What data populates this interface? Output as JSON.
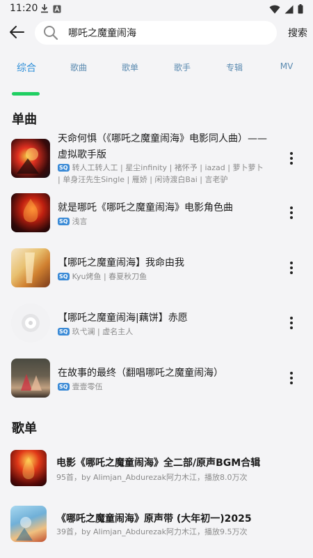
{
  "status_bar": {
    "time": "11:20",
    "icons": [
      "download-icon",
      "a-icon",
      "wifi-icon",
      "signal-icon",
      "battery-icon"
    ]
  },
  "header": {
    "search_query": "哪吒之魔童闹海",
    "search_button": "搜索"
  },
  "tabs": [
    {
      "label": "综合",
      "active": true
    },
    {
      "label": "歌曲",
      "active": false
    },
    {
      "label": "歌单",
      "active": false
    },
    {
      "label": "歌手",
      "active": false
    },
    {
      "label": "专辑",
      "active": false
    },
    {
      "label": "MV",
      "active": false
    }
  ],
  "songs_section": {
    "title": "单曲",
    "items": [
      {
        "title": "天命何惧（《哪吒之魔童闹海》电影同人曲）——虚拟歌手版",
        "quality": "SQ",
        "artists": "转人工转人工 | 星尘infinity | 褚怀予 | iazad | 萝卜萝卜 | 单身汪先生Single | 雁娇 | 闲诗渡白Bai | 言老驴"
      },
      {
        "title": "就是哪吒《哪吒之魔童闹海》电影角色曲",
        "quality": "SQ",
        "artists": "浅言"
      },
      {
        "title": "【哪吒之魔童闹海】我命由我",
        "quality": "SQ",
        "artists": "Kyu烤鱼 | 春夏秋刀鱼"
      },
      {
        "title": "【哪吒之魔童闹海|藕饼】赤愿",
        "quality": "SQ",
        "artists": "玖弋澜 | 虚名主人"
      },
      {
        "title": "在故事的最终（翻唱哪吒之魔童闹海）",
        "quality": "SQ",
        "artists": "壹壹零伍"
      }
    ]
  },
  "playlists_section": {
    "title": "歌单",
    "items": [
      {
        "title": "电影《哪吒之魔童闹海》全二部/原声BGM合辑",
        "meta": "95首，by Alimjan_Abdurezak阿力木江，播放8.0万次"
      },
      {
        "title": "《哪吒之魔童闹海》原声带 (大年初一)2025",
        "meta": "39首，by Alimjan_Abdurezak阿力木江，播放9.5万次"
      }
    ]
  }
}
